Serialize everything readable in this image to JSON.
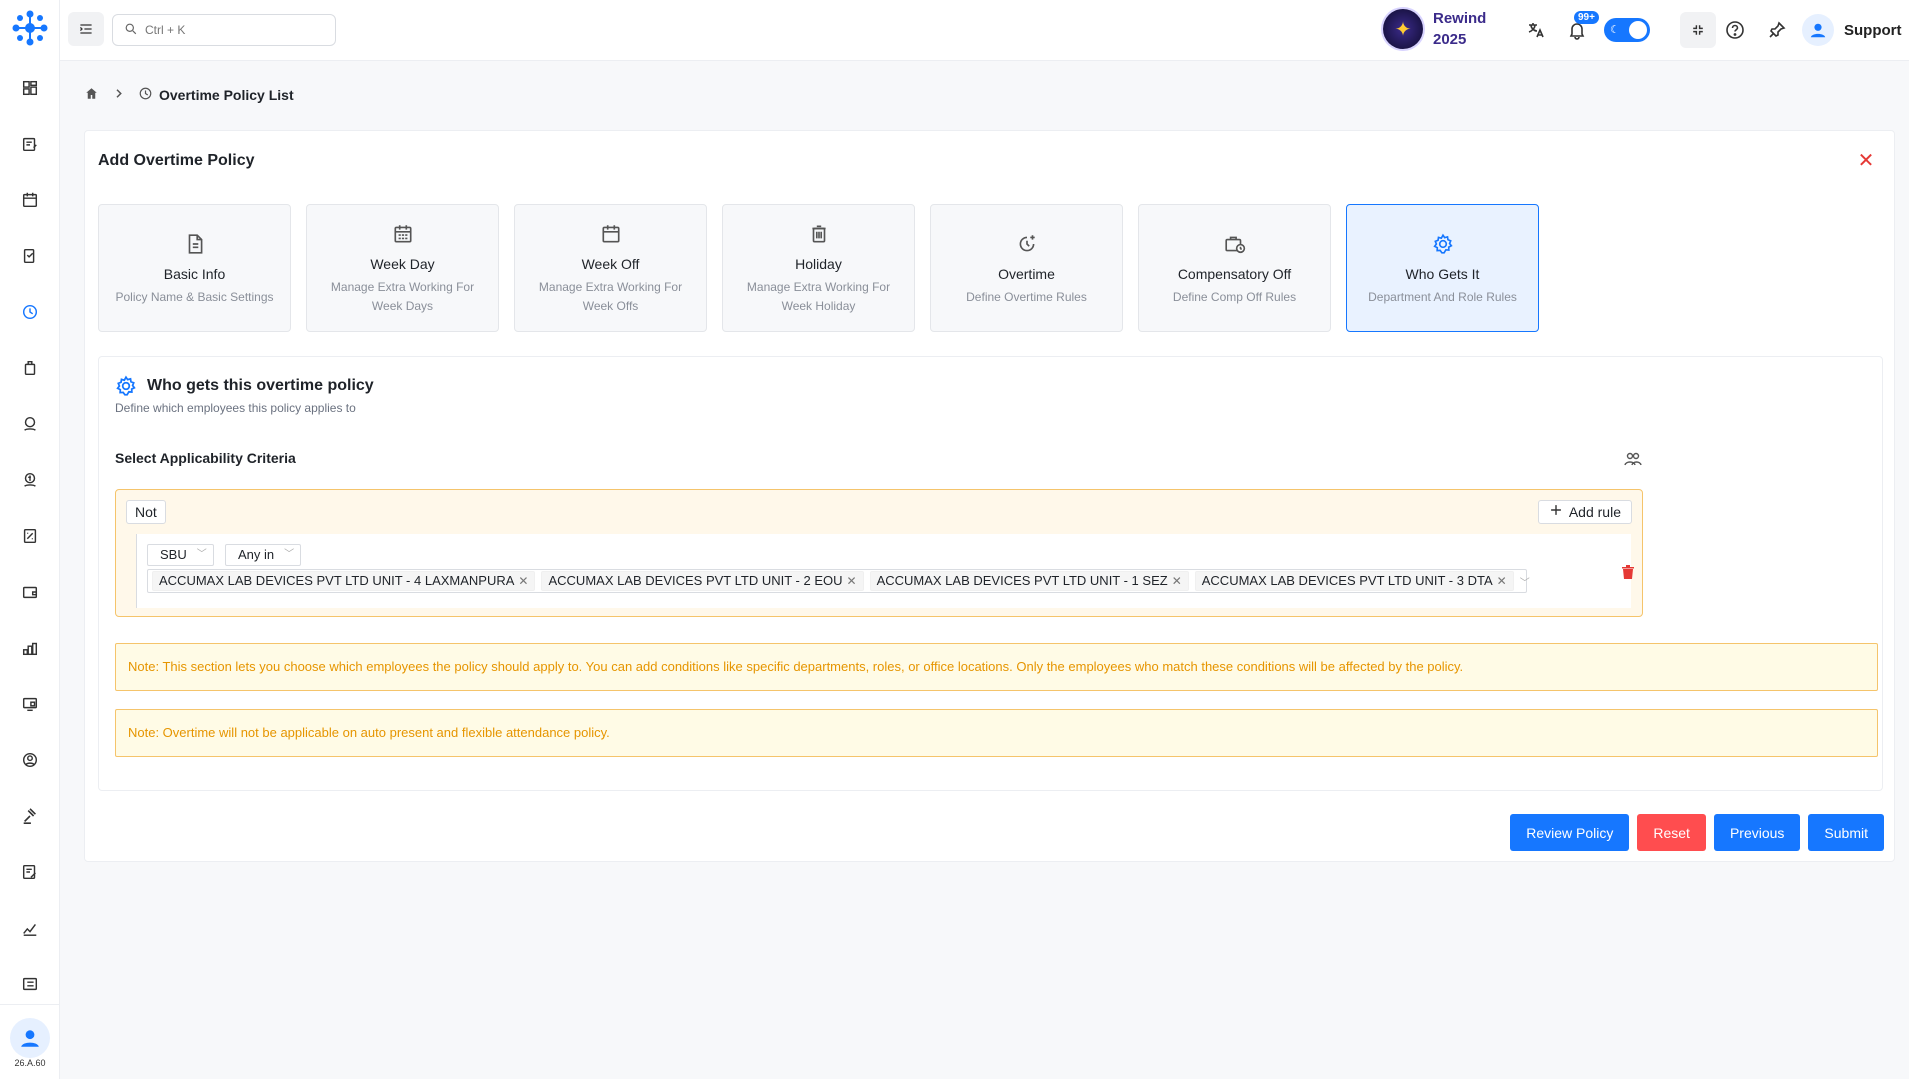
{
  "header": {
    "search_placeholder": "Ctrl + K",
    "rewind_line1": "Rewind",
    "rewind_line2": "2025",
    "notifications_badge": "99+",
    "support_label": "Support"
  },
  "sidebar": {
    "version": "26.A.60",
    "items": [
      "dashboard-icon",
      "tasks-icon",
      "calendar-icon",
      "attendance-icon",
      "overtime-icon",
      "leave-icon",
      "payroll-icon",
      "expense-icon",
      "reports-icon",
      "wallet-icon",
      "org-chart-icon",
      "assets-icon",
      "profile-icon",
      "legal-icon",
      "forms-icon",
      "analytics-icon",
      "settings-icon"
    ],
    "active_index": 4
  },
  "breadcrumb": {
    "current": "Overtime Policy List"
  },
  "card": {
    "title": "Add Overtime Policy"
  },
  "steps": [
    {
      "title": "Basic Info",
      "desc": "Policy Name & Basic Settings",
      "icon": "file-icon"
    },
    {
      "title": "Week Day",
      "desc": "Manage Extra Working For Week Days",
      "icon": "calendar-grid-icon"
    },
    {
      "title": "Week Off",
      "desc": "Manage Extra Working For Week Offs",
      "icon": "calendar-icon"
    },
    {
      "title": "Holiday",
      "desc": "Manage Extra Working For Week Holiday",
      "icon": "trash-calendar-icon"
    },
    {
      "title": "Overtime",
      "desc": "Define Overtime Rules",
      "icon": "clock-plus-icon"
    },
    {
      "title": "Compensatory Off",
      "desc": "Define Comp Off Rules",
      "icon": "briefcase-clock-icon"
    },
    {
      "title": "Who Gets It",
      "desc": "Department And Role Rules",
      "icon": "gear-icon"
    }
  ],
  "active_step": 6,
  "section": {
    "title": "Who gets this overtime policy",
    "subtitle": "Define which employees this policy applies to",
    "criteria_label": "Select Applicability Criteria"
  },
  "rule": {
    "not_label": "Not",
    "add_rule_label": "Add rule",
    "field": "SBU",
    "operator": "Any in",
    "values": [
      "ACCUMAX LAB DEVICES PVT LTD UNIT - 4 LAXMANPURA",
      "ACCUMAX LAB DEVICES PVT LTD UNIT - 2 EOU",
      "ACCUMAX LAB DEVICES PVT LTD UNIT - 1 SEZ",
      "ACCUMAX LAB DEVICES PVT LTD UNIT - 3 DTA"
    ]
  },
  "notes": {
    "note1": "Note: This section lets you choose which employees the policy should apply to. You can add conditions like specific departments, roles, or office locations. Only the employees who match these conditions will be affected by the policy.",
    "note2": "Note: Overtime will not be applicable on auto present and flexible attendance policy."
  },
  "actions": {
    "review": "Review Policy",
    "reset": "Reset",
    "previous": "Previous",
    "submit": "Submit"
  },
  "colors": {
    "primary": "#1677ff",
    "danger": "#ff4d4f",
    "note_text": "#e69500",
    "note_bg": "#fffbe6"
  }
}
